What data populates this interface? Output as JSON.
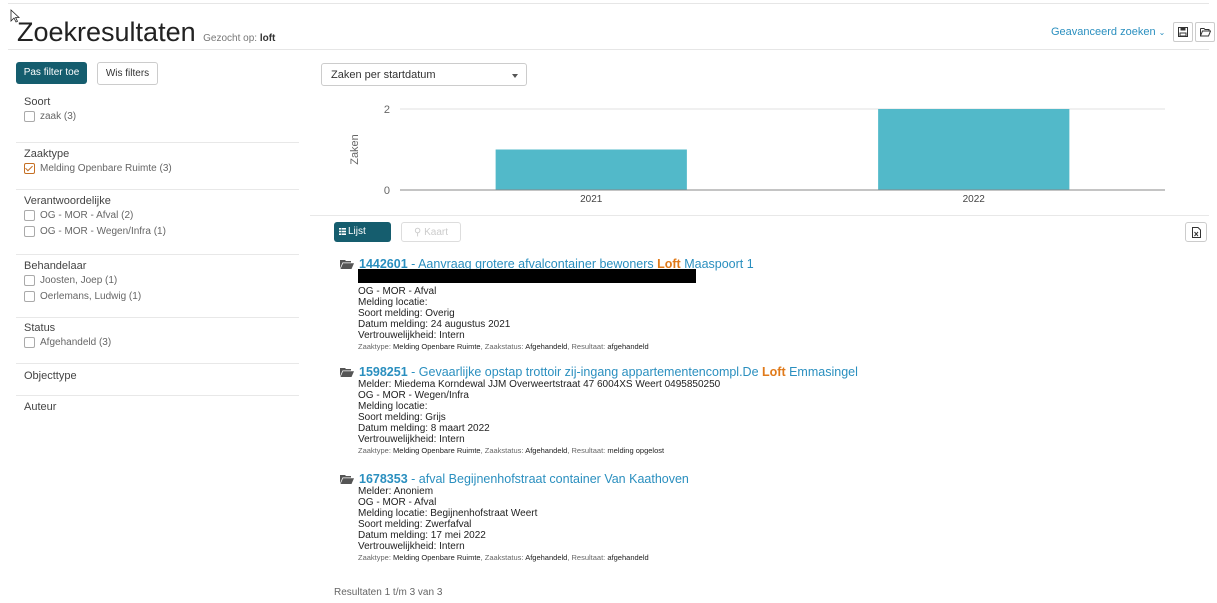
{
  "header": {
    "title": "Zoekresultaten",
    "searched_on_label": "Gezocht op:",
    "query": "loft",
    "advanced_search": "Geavanceerd zoeken"
  },
  "sidebar": {
    "apply_filter": "Pas filter toe",
    "clear_filters": "Wis filters",
    "facets": [
      {
        "title": "Soort",
        "options": [
          {
            "label": "zaak (3)",
            "checked": false
          }
        ]
      },
      {
        "title": "Zaaktype",
        "options": [
          {
            "label": "Melding Openbare Ruimte (3)",
            "checked": true
          }
        ]
      },
      {
        "title": "Verantwoordelijke",
        "options": [
          {
            "label": "OG - MOR - Afval (2)",
            "checked": false
          },
          {
            "label": "OG - MOR - Wegen/Infra (1)",
            "checked": false
          }
        ]
      },
      {
        "title": "Behandelaar",
        "options": [
          {
            "label": "Joosten, Joep (1)",
            "checked": false
          },
          {
            "label": "Oerlemans, Ludwig (1)",
            "checked": false
          }
        ]
      },
      {
        "title": "Status",
        "options": [
          {
            "label": "Afgehandeld (3)",
            "checked": false
          }
        ]
      },
      {
        "title": "Objecttype",
        "options": []
      },
      {
        "title": "Auteur",
        "options": []
      }
    ]
  },
  "chart_select": {
    "value": "Zaken per startdatum"
  },
  "chart_data": {
    "type": "bar",
    "categories": [
      "2021",
      "2022"
    ],
    "values": [
      1,
      2
    ],
    "ylabel": "Zaken",
    "yticks": [
      0,
      2
    ],
    "ylim": [
      0,
      2
    ],
    "color": "#52b9c9",
    "grid": true
  },
  "view_toggle": {
    "list": "Lijst",
    "map": "Kaart"
  },
  "results": [
    {
      "id": "1442601",
      "title_pre": " - Aanvraag grotere afvalcontainer bewoners ",
      "highlight": "Loft",
      "title_post": " Maaspoort 1",
      "lines": [
        "OG - MOR - Afval",
        "Melding locatie:",
        "Soort melding: Overig",
        "Datum melding: 24 augustus 2021",
        "Vertrouwelijkheid: Intern"
      ],
      "meta": {
        "zaaktype_label": "Zaaktype:",
        "zaaktype": "Melding Openbare Ruimte",
        "status_label": "Zaakstatus:",
        "status": "Afgehandeld",
        "result_label": "Resultaat:",
        "result": "afgehandeld"
      }
    },
    {
      "id": "1598251",
      "title_pre": " - Gevaarlijke opstap trottoir zij-ingang appartementencompl.De ",
      "highlight": "Loft",
      "title_post": " Emmasingel",
      "lines": [
        "Melder: Miedema Korndewal JJM Overweertstraat 47 6004XS Weert 0495850250",
        "OG - MOR - Wegen/Infra",
        "Melding locatie:",
        "Soort melding: Grijs",
        "Datum melding: 8 maart 2022",
        "Vertrouwelijkheid: Intern"
      ],
      "meta": {
        "zaaktype_label": "Zaaktype:",
        "zaaktype": "Melding Openbare Ruimte",
        "status_label": "Zaakstatus:",
        "status": "Afgehandeld",
        "result_label": "Resultaat:",
        "result": "melding opgelost"
      }
    },
    {
      "id": "1678353",
      "title_pre": " - afval Begijnenhofstraat container Van Kaathoven",
      "highlight": "",
      "title_post": "",
      "lines": [
        "Melder: Anoniem",
        "OG - MOR - Afval",
        "Melding locatie: Begijnenhofstraat Weert",
        "Soort melding: Zwerfafval",
        "Datum melding: 17 mei 2022",
        "Vertrouwelijkheid: Intern"
      ],
      "meta": {
        "zaaktype_label": "Zaaktype:",
        "zaaktype": "Melding Openbare Ruimte",
        "status_label": "Zaakstatus:",
        "status": "Afgehandeld",
        "result_label": "Resultaat:",
        "result": "afgehandeld"
      }
    }
  ],
  "footer": {
    "summary": "Resultaten 1 t/m 3 van 3"
  }
}
